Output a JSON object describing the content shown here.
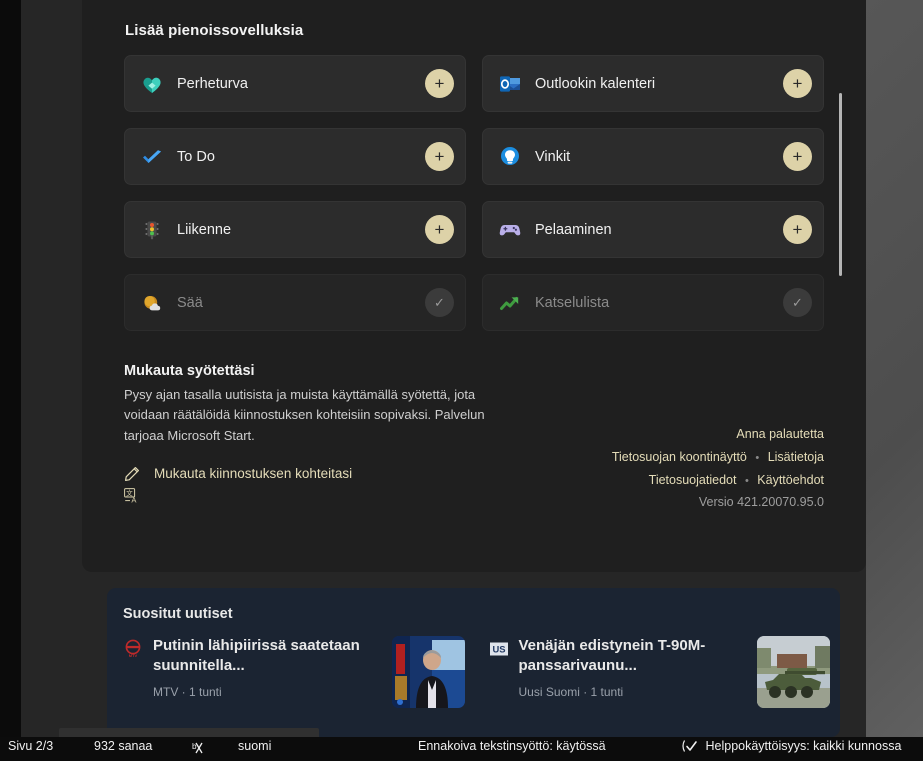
{
  "widgets_panel": {
    "title": "Lisää pienoissovelluksia",
    "widgets": [
      {
        "label": "Perheturva",
        "icon": "family-safety-icon",
        "state": "add",
        "button_label": "+"
      },
      {
        "label": "Outlookin kalenteri",
        "icon": "outlook-calendar-icon",
        "state": "add",
        "button_label": "+"
      },
      {
        "label": "To Do",
        "icon": "to-do-icon",
        "state": "add",
        "button_label": "+"
      },
      {
        "label": "Vinkit",
        "icon": "tips-lightbulb-icon",
        "state": "add",
        "button_label": "+"
      },
      {
        "label": "Liikenne",
        "icon": "traffic-light-icon",
        "state": "add",
        "button_label": "+"
      },
      {
        "label": "Pelaaminen",
        "icon": "gaming-controller-icon",
        "state": "add",
        "button_label": "+"
      },
      {
        "label": "Sää",
        "icon": "weather-icon",
        "state": "installed",
        "button_label": "✓"
      },
      {
        "label": "Katselulista",
        "icon": "watchlist-chart-icon",
        "state": "installed",
        "button_label": "✓"
      }
    ],
    "personalize": {
      "title": "Mukauta syötettäsi",
      "body": "Pysy ajan tasalla uutisista ja muista käyttämällä syötettä, jota voidaan räätälöidä kiinnostuksen kohteisiin sopivaksi. Palvelun tarjoaa Microsoft Start.",
      "action_label": "Mukauta kiinnostuksen kohteitasi"
    },
    "links": {
      "feedback": "Anna palautetta",
      "privacy_dashboard": "Tietosuojan koontinäyttö",
      "learn_more": "Lisätietoja",
      "privacy_statement": "Tietosuojatiedot",
      "terms": "Käyttöehdot",
      "version": "Versio 421.20070.95.0",
      "separator": "•"
    }
  },
  "news": {
    "title": "Suositut uutiset",
    "items": [
      {
        "headline": "Putinin lähipiirissä saatetaan suunnitella...",
        "source": "MTV",
        "time": "1 tunti",
        "meta": "MTV · 1 tunti",
        "logo_text": "MTV"
      },
      {
        "headline": "Venäjän edistynein T-90M-panssarivaunu...",
        "source": "Uusi Suomi",
        "time": "1 tunti",
        "meta": "Uusi Suomi · 1 tunti",
        "logo_text": "US"
      }
    ]
  },
  "statusbar": {
    "page": "Sivu 2/3",
    "words": "932 sanaa",
    "proofing_icon": "proofing-errors-icon",
    "language": "suomi",
    "predictive_text": "Ennakoiva tekstinsyöttö: käytössä",
    "accessibility": "Helppokäyttöisyys: kaikki kunnossa"
  },
  "colors": {
    "panel_bg": "#1f1f1f",
    "card_bg": "#2c2c2c",
    "accent_button": "#ddd2a8",
    "link": "#e4dcb8",
    "news_bg": "#1b2432"
  }
}
